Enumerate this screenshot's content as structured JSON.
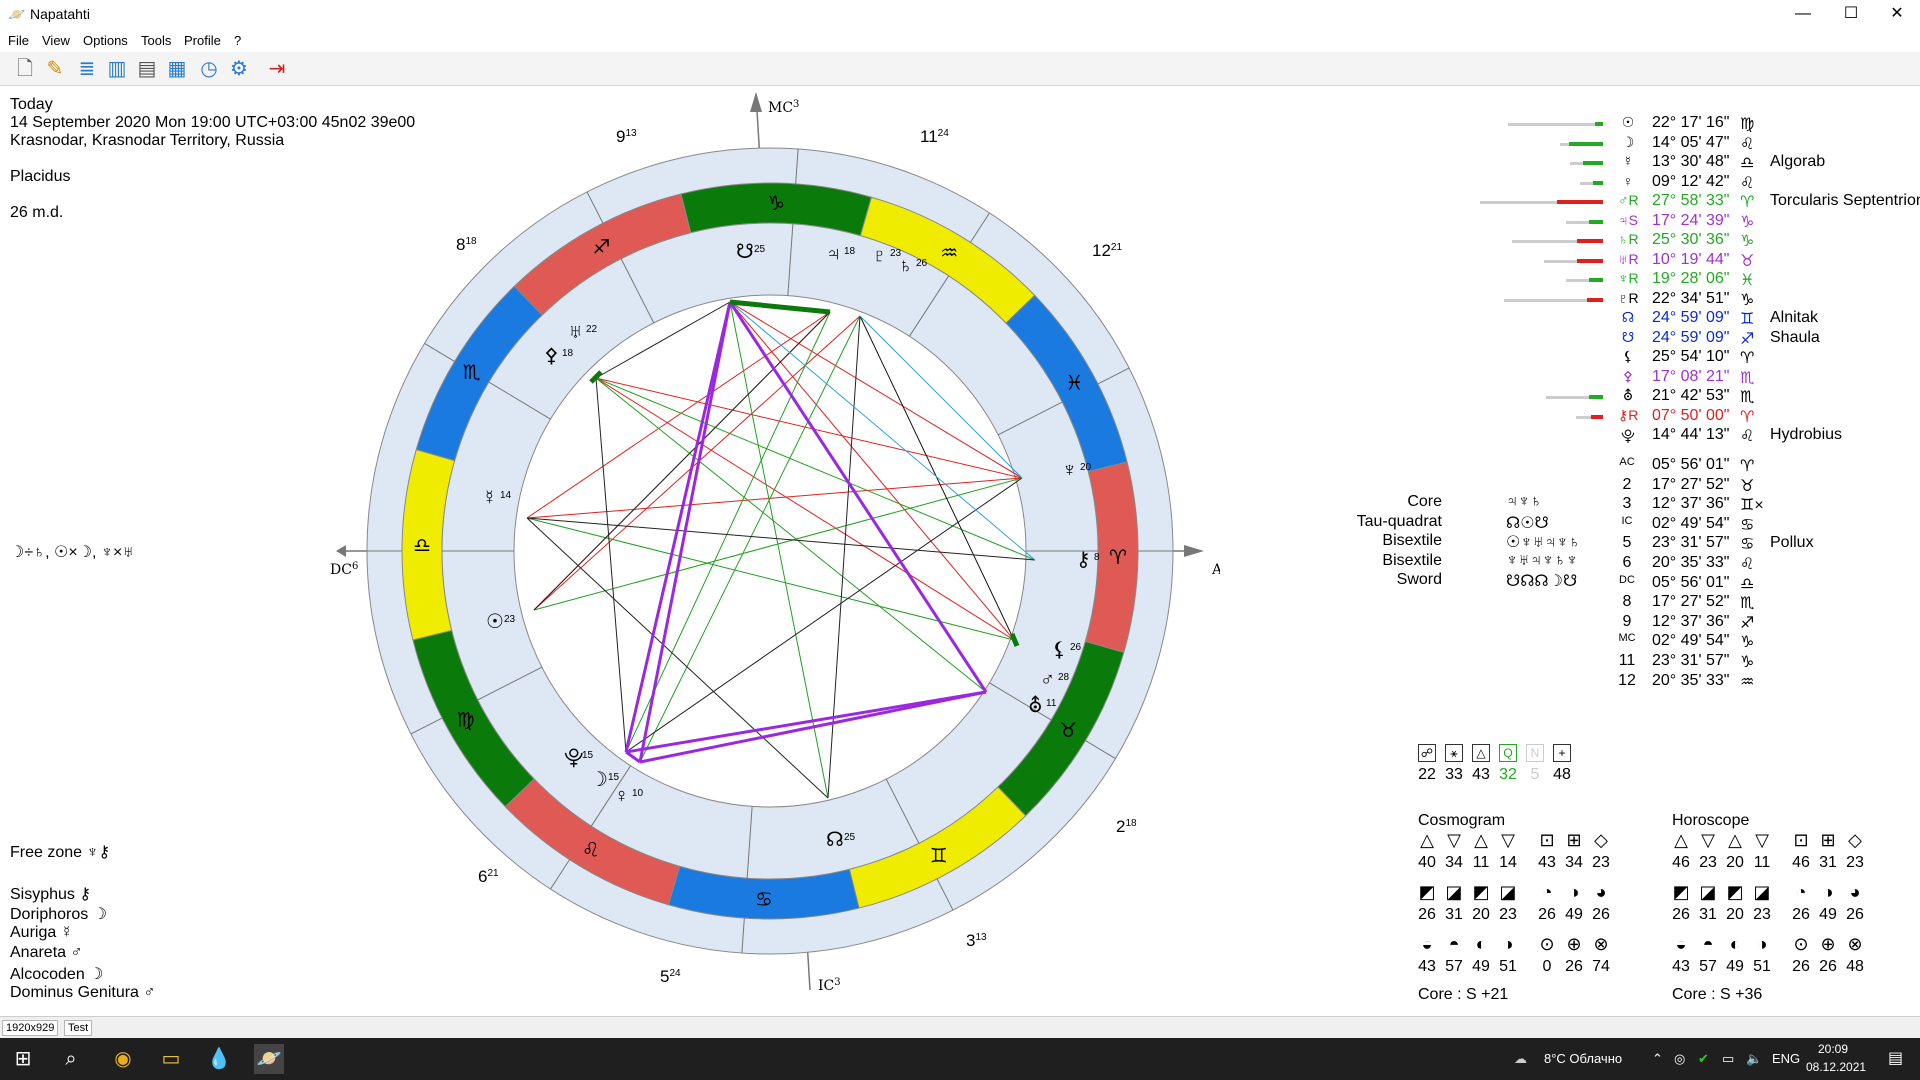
{
  "window": {
    "title": "Napatahti",
    "minimize": "—",
    "maximize": "☐",
    "close": "✕"
  },
  "menu": {
    "file": "File",
    "view": "View",
    "options": "Options",
    "tools": "Tools",
    "profile": "Profile",
    "help": "?"
  },
  "info": {
    "line1": "Today",
    "line2": "14 September 2020 Mon 19:00 UTC+03:00 45n02 39e00",
    "line3": "Krasnodar, Krasnodar Territory, Russia",
    "house_system": "Placidus",
    "md": "26 m.d.",
    "aspects_note": "☽÷♄, ☉×☽, ♆×♅"
  },
  "bottom_left": {
    "free_zone": "Free zone ♆⚷",
    "sisyphus": "Sisyphus ⚷",
    "doriphoros": "Doriphoros ☽",
    "auriga": "Auriga ☿",
    "anareta": "Anareta ♂",
    "alcocoden": "Alcocoden ☽",
    "dominus": "Dominus Genitura ♂"
  },
  "chart_labels": {
    "mc": "MC",
    "mc_sup": "3",
    "ic": "IC",
    "ic_sup": "3",
    "ac": "AC",
    "ac_sup": "6",
    "dc": "DC",
    "dc_sup": "6",
    "h9": "9",
    "h9s": "13",
    "h11": "11",
    "h11s": "24",
    "h8": "8",
    "h8s": "18",
    "h12": "12",
    "h12s": "21",
    "h6": "6",
    "h6s": "21",
    "h2": "2",
    "h2s": "18",
    "h5": "5",
    "h5s": "24",
    "h3": "3",
    "h3s": "13"
  },
  "zodiac": [
    {
      "glyph": "♑",
      "color": "#0a7a0a"
    },
    {
      "glyph": "♒",
      "color": "#f0ec00"
    },
    {
      "glyph": "♓",
      "color": "#1a7ae0"
    },
    {
      "glyph": "♈",
      "color": "#e05a55"
    },
    {
      "glyph": "♉",
      "color": "#0a7a0a"
    },
    {
      "glyph": "♊",
      "color": "#f0ec00"
    },
    {
      "glyph": "♋",
      "color": "#1a7ae0"
    },
    {
      "glyph": "♌",
      "color": "#e05a55"
    },
    {
      "glyph": "♍",
      "color": "#0a7a0a"
    },
    {
      "glyph": "♎",
      "color": "#f0ec00"
    },
    {
      "glyph": "♏",
      "color": "#1a7ae0"
    },
    {
      "glyph": "♐",
      "color": "#e05a55"
    }
  ],
  "planets_chart": [
    {
      "g": "☋",
      "n": "25"
    },
    {
      "g": "♃",
      "n": "18"
    },
    {
      "g": "♇",
      "n": "23"
    },
    {
      "g": "♄",
      "n": "26"
    },
    {
      "g": "♅",
      "n": "22"
    },
    {
      "g": "⚴",
      "n": "18"
    },
    {
      "g": "☿",
      "n": "14"
    },
    {
      "g": "♆",
      "n": "20"
    },
    {
      "g": "⚷",
      "n": "8"
    },
    {
      "g": "☉",
      "n": "23"
    },
    {
      "g": "⚸",
      "n": "26"
    },
    {
      "g": "♂",
      "n": "28"
    },
    {
      "g": "⛢",
      "n": "11"
    },
    {
      "g": "⯓",
      "n": "15"
    },
    {
      "g": "☽",
      "n": "15"
    },
    {
      "g": "♀",
      "n": "10"
    },
    {
      "g": "☊",
      "n": "25"
    }
  ],
  "planets": [
    {
      "sym": "☉",
      "deg": "22° 17' 16\"",
      "sign": "♍",
      "star": "",
      "color": "#000",
      "bar": 92,
      "cbar": 8,
      "cc": "#22aa22"
    },
    {
      "sym": "☽",
      "deg": "14° 05' 47\"",
      "sign": "♌",
      "star": "",
      "color": "#000",
      "bar": 40,
      "cbar": 34,
      "cc": "#22aa22"
    },
    {
      "sym": "☿",
      "deg": "13° 30' 48\"",
      "sign": "♎",
      "star": "Algorab",
      "color": "#000",
      "bar": 30,
      "cbar": 20,
      "cc": "#22aa22"
    },
    {
      "sym": "♀",
      "deg": "09° 12' 42\"",
      "sign": "♌",
      "star": "",
      "color": "#000",
      "bar": 20,
      "cbar": 10,
      "cc": "#22aa22"
    },
    {
      "sym": "♂R",
      "deg": "27° 58' 33\"",
      "sign": "♈",
      "star": "Torcularis Septentrionalis",
      "color": "#22aa22",
      "bar": 120,
      "cbar": 46,
      "cc": "#e02020"
    },
    {
      "sym": "♃S",
      "deg": "17° 24' 39\"",
      "sign": "♑",
      "star": "",
      "color": "#a030d0",
      "bar": 34,
      "cbar": 14,
      "cc": "#22aa22"
    },
    {
      "sym": "♄R",
      "deg": "25° 30' 36\"",
      "sign": "♑",
      "star": "",
      "color": "#22aa22",
      "bar": 88,
      "cbar": 26,
      "cc": "#e02020"
    },
    {
      "sym": "♅R",
      "deg": "10° 19' 44\"",
      "sign": "♉",
      "star": "",
      "color": "#a030d0",
      "bar": 56,
      "cbar": 26,
      "cc": "#e02020"
    },
    {
      "sym": "♆R",
      "deg": "19° 28' 06\"",
      "sign": "♓",
      "star": "",
      "color": "#22aa22",
      "bar": 34,
      "cbar": 14,
      "cc": "#22aa22"
    },
    {
      "sym": "♇R",
      "deg": "22° 34' 51\"",
      "sign": "♑",
      "star": "",
      "color": "#000",
      "bar": 96,
      "cbar": 16,
      "cc": "#e02020"
    },
    {
      "sym": "☊",
      "deg": "24° 59' 09\"",
      "sign": "♊",
      "star": "Alnitak",
      "color": "#0a2ad0",
      "bar": 0,
      "cbar": 0,
      "cc": ""
    },
    {
      "sym": "☋",
      "deg": "24° 59' 09\"",
      "sign": "♐",
      "star": "Shaula",
      "color": "#0a2ad0",
      "bar": 0,
      "cbar": 0,
      "cc": ""
    },
    {
      "sym": "⚸",
      "deg": "25° 54' 10\"",
      "sign": "♈",
      "star": "",
      "color": "#000",
      "bar": 0,
      "cbar": 0,
      "cc": ""
    },
    {
      "sym": "⚴",
      "deg": "17° 08' 21\"",
      "sign": "♏",
      "star": "",
      "color": "#a030d0",
      "bar": 0,
      "cbar": 0,
      "cc": ""
    },
    {
      "sym": "⛢",
      "deg": "21° 42' 53\"",
      "sign": "♏",
      "star": "",
      "color": "#000",
      "bar": 54,
      "cbar": 14,
      "cc": "#22aa22"
    },
    {
      "sym": "⚷R",
      "deg": "07° 50' 00\"",
      "sign": "♈",
      "star": "",
      "color": "#e02020",
      "bar": 24,
      "cbar": 12,
      "cc": "#e02020"
    },
    {
      "sym": "⯓",
      "deg": "14° 44' 13\"",
      "sign": "♌",
      "star": "Hydrobius",
      "color": "#000",
      "bar": 0,
      "cbar": 0,
      "cc": ""
    }
  ],
  "houses": [
    {
      "n": "AC",
      "deg": "05° 56' 01\"",
      "sign": "♈",
      "star": ""
    },
    {
      "n": "2",
      "deg": "17° 27' 52\"",
      "sign": "♉",
      "star": ""
    },
    {
      "n": "3",
      "deg": "12° 37' 36\"",
      "sign": "♊×",
      "star": ""
    },
    {
      "n": "IC",
      "deg": "02° 49' 54\"",
      "sign": "♋",
      "star": ""
    },
    {
      "n": "5",
      "deg": "23° 31' 57\"",
      "sign": "♋",
      "star": "Pollux"
    },
    {
      "n": "6",
      "deg": "20° 35' 33\"",
      "sign": "♌",
      "star": ""
    },
    {
      "n": "DC",
      "deg": "05° 56' 01\"",
      "sign": "♎",
      "star": ""
    },
    {
      "n": "8",
      "deg": "17° 27' 52\"",
      "sign": "♏",
      "star": ""
    },
    {
      "n": "9",
      "deg": "12° 37' 36\"",
      "sign": "♐",
      "star": ""
    },
    {
      "n": "MC",
      "deg": "02° 49' 54\"",
      "sign": "♑",
      "star": ""
    },
    {
      "n": "11",
      "deg": "23° 31' 57\"",
      "sign": "♑",
      "star": ""
    },
    {
      "n": "12",
      "deg": "20° 35' 33\"",
      "sign": "♒",
      "star": ""
    }
  ],
  "configs": [
    {
      "name": "Core",
      "glyphs": "♃♆♄"
    },
    {
      "name": "Tau-quadrat",
      "glyphs": "☊☉☋"
    },
    {
      "name": "Bisextile",
      "glyphs": "☉♆♅♃♆♄"
    },
    {
      "name": "Bisextile",
      "glyphs": "♆♅♃♆♄♆"
    },
    {
      "name": "Sword",
      "glyphs": "☋☊☊☽☋"
    }
  ],
  "aspect_counts": [
    {
      "icon": "☍",
      "v": "22"
    },
    {
      "icon": "⚹",
      "v": "33"
    },
    {
      "icon": "△",
      "v": "43"
    },
    {
      "icon": "Q",
      "v": "32"
    },
    {
      "icon": "N",
      "v": "5"
    },
    {
      "icon": "+",
      "v": "48"
    }
  ],
  "cosmogram": {
    "title": "Cosmogram",
    "r1": [
      "40",
      "34",
      "11",
      "14",
      "43",
      "34",
      "23"
    ],
    "r2": [
      "26",
      "31",
      "20",
      "23",
      "26",
      "49",
      "26"
    ],
    "r3": [
      "43",
      "57",
      "49",
      "51",
      "0",
      "26",
      "74"
    ],
    "core": "Core :  S +21"
  },
  "horoscope": {
    "title": "Horoscope",
    "r1": [
      "46",
      "23",
      "20",
      "11",
      "46",
      "31",
      "23"
    ],
    "r2": [
      "26",
      "31",
      "20",
      "23",
      "26",
      "49",
      "26"
    ],
    "r3": [
      "43",
      "57",
      "49",
      "51",
      "26",
      "26",
      "48"
    ],
    "core": "Core :  S +36"
  },
  "status": {
    "size": "1920x929",
    "mode": "Test"
  },
  "taskbar": {
    "weather": "8°C  Облачно",
    "lang": "ENG",
    "time": "20:09",
    "date": "08.12.2021"
  }
}
